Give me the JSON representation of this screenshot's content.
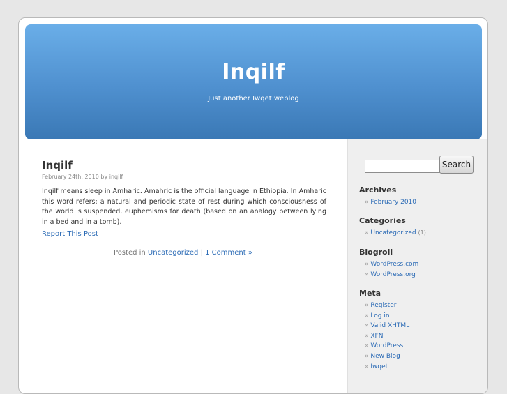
{
  "header": {
    "title": "Inqilf",
    "description": "Just another Iwqet weblog"
  },
  "post": {
    "title": "Inqilf",
    "meta": "February 24th, 2010 by inqilf",
    "body": "Inqilf means sleep in Amharic. Amahric is the official language in Ethiopia. In Amharic this word refers: a natural and periodic state of rest during which consciousness of the world is suspended, euphemisms for death (based on an analogy between lying in a bed and in a tomb).",
    "report_link": "Report This Post",
    "posted_in_prefix": "Posted in",
    "category": "Uncategorized",
    "separator": "|",
    "comments": "1 Comment »"
  },
  "sidebar": {
    "search": {
      "placeholder": "",
      "button_label": "Search"
    },
    "bullet": "»",
    "archives": {
      "title": "Archives",
      "items": [
        "February 2010"
      ]
    },
    "categories": {
      "title": "Categories",
      "items": [
        {
          "label": "Uncategorized",
          "count": "(1)"
        }
      ]
    },
    "blogroll": {
      "title": "Blogroll",
      "items": [
        "WordPress.com",
        "WordPress.org"
      ]
    },
    "meta": {
      "title": "Meta",
      "items": [
        "Register",
        "Log in",
        "Valid XHTML",
        "XFN",
        "WordPress",
        "New Blog",
        "Iwqet"
      ]
    }
  }
}
